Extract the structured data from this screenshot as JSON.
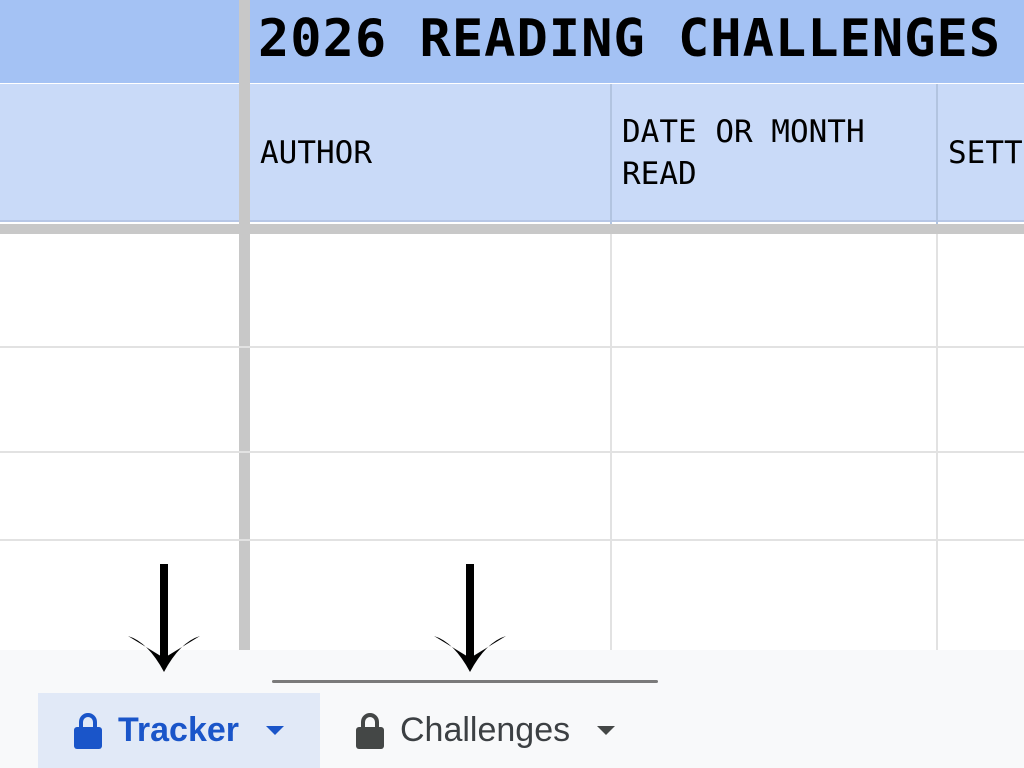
{
  "sheet": {
    "title": "2026 READING CHALLENGES",
    "columns": [
      {
        "label": ""
      },
      {
        "label": "AUTHOR"
      },
      {
        "label": "DATE OR MONTH\nREAD"
      },
      {
        "label": "SETT"
      }
    ],
    "rows": [
      [
        "",
        "",
        "",
        ""
      ],
      [
        "",
        "",
        "",
        ""
      ],
      [
        "",
        "",
        "",
        ""
      ],
      [
        "",
        "",
        "",
        ""
      ]
    ]
  },
  "tabs": [
    {
      "label": "Tracker",
      "active": true,
      "icon": "lock-icon",
      "color": "#1a55c9"
    },
    {
      "label": "Challenges",
      "active": false,
      "icon": "lock-icon",
      "color": "#3c4043"
    }
  ],
  "colors": {
    "title_bg": "#a4c2f4",
    "header_bg": "#c9daf8",
    "active_tab_bg": "#e1e9f7",
    "tab_bar_bg": "#f8f9fa"
  },
  "annotations": [
    {
      "icon": "down-arrow-icon",
      "points_to": "Tracker"
    },
    {
      "icon": "down-arrow-icon",
      "points_to": "Challenges"
    }
  ]
}
